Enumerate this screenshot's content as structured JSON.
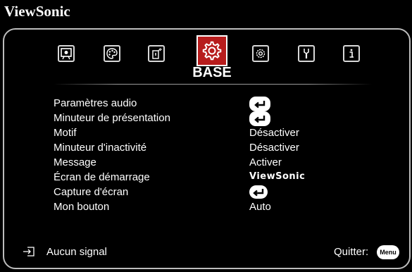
{
  "brand": "ViewSonic",
  "tabs": [
    {
      "icon": "display-icon"
    },
    {
      "icon": "palette-icon"
    },
    {
      "icon": "power-icon"
    },
    {
      "icon": "gear-icon",
      "active": true,
      "label": "BASE"
    },
    {
      "icon": "advanced-gear-icon"
    },
    {
      "icon": "wrench-icon"
    },
    {
      "icon": "info-icon"
    }
  ],
  "active_tab_label": "BASE",
  "rows": [
    {
      "label": "Paramètres audio",
      "type": "enter"
    },
    {
      "label": "Minuteur de présentation",
      "type": "enter"
    },
    {
      "label": "Motif",
      "value": "Désactiver"
    },
    {
      "label": "Minuteur d'inactivité",
      "value": "Désactiver"
    },
    {
      "label": "Message",
      "value": "Activer"
    },
    {
      "label": "Écran de démarrage",
      "value": "ViewSonic"
    },
    {
      "label": "Capture d'écran",
      "type": "enter"
    },
    {
      "label": "Mon bouton",
      "value": "Auto"
    }
  ],
  "footer": {
    "signal_text": "Aucun signal",
    "quit_label": "Quitter:",
    "menu_button": "Menu"
  },
  "colors": {
    "background": "#000000",
    "accent": "#b71c1c",
    "text": "#ffffff",
    "border": "#bdbdbd"
  }
}
